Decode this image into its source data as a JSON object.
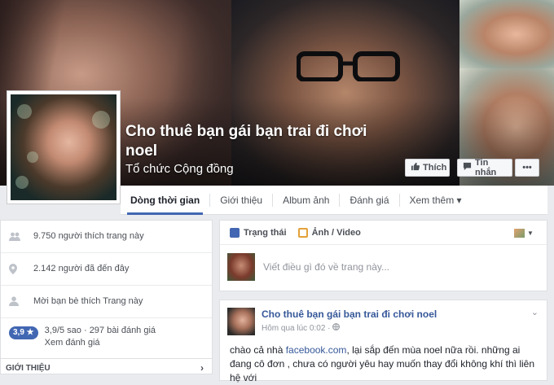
{
  "page": {
    "title": "Cho thuê bạn gái bạn trai đi chơi noel",
    "category": "Tổ chức Cộng đồng"
  },
  "actions": {
    "like_label": "Thích",
    "message_label": "Tin nhắn",
    "more_label": "•••"
  },
  "nav": {
    "tabs": [
      {
        "label": "Dòng thời gian",
        "active": true
      },
      {
        "label": "Giới thiệu"
      },
      {
        "label": "Album ảnh"
      },
      {
        "label": "Đánh giá"
      },
      {
        "label": "Xem thêm ▾"
      }
    ]
  },
  "stats": {
    "likes": "9.750 người thích trang này",
    "visits": "2.142 người đã đến đây",
    "friends": "Mời bạn bè thích Trang này",
    "rating_badge": "3,9 ★",
    "rating_text": "3,9/5 sao · 297 bài đánh giá",
    "rating_link": "Xem đánh giá"
  },
  "about": {
    "heading": "GIỚI THIỆU"
  },
  "composer": {
    "status_tab": "Trạng thái",
    "photo_tab": "Ảnh / Video",
    "placeholder": "Viết điều gì đó về trang này..."
  },
  "post": {
    "author": "Cho thuê bạn gái bạn trai đi chơi noel",
    "time": "Hôm qua lúc 0:02 · ",
    "text_1": "chào cả nhà ",
    "link": "facebook.com",
    "text_2": ", lại sắp đến mùa noel nữa rồi. những ai đang cô đơn , chưa có người yêu hay muốn thay đổi không khí thì liên hệ với"
  },
  "colors": {
    "accent": "#4267b2",
    "link": "#365899",
    "background": "#e9ebee"
  }
}
